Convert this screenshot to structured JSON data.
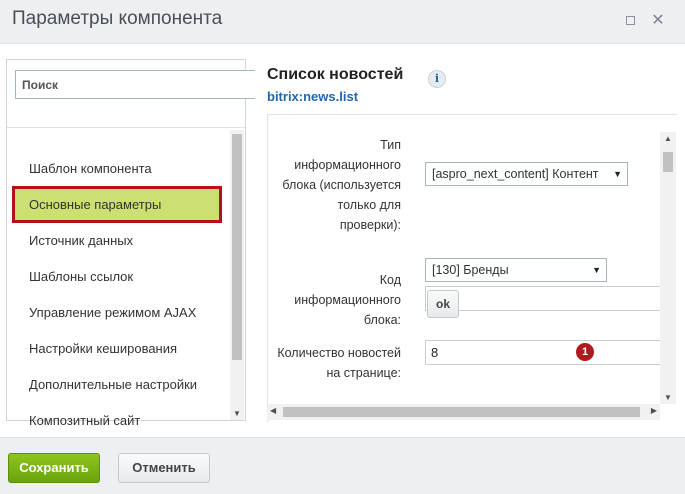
{
  "window": {
    "title": "Параметры компонента",
    "maximize_icon": "maximize-icon",
    "close_icon": "close-icon",
    "close_glyph": "✕"
  },
  "sidebar": {
    "search_placeholder": "Поиск",
    "items": [
      {
        "label": "Шаблон компонента"
      },
      {
        "label": "Основные параметры",
        "active": true
      },
      {
        "label": "Источник данных"
      },
      {
        "label": "Шаблоны ссылок"
      },
      {
        "label": "Управление режимом AJAX"
      },
      {
        "label": "Настройки кеширования"
      },
      {
        "label": "Дополнительные настройки"
      },
      {
        "label": "Композитный сайт"
      }
    ]
  },
  "component": {
    "title": "Список новостей",
    "info_glyph": "i",
    "code": "bitrix:news.list"
  },
  "properties": {
    "iblock_type": {
      "label_lines": [
        "Тип",
        "информационного",
        "блока (используется",
        "только для",
        "проверки):"
      ],
      "value": "[aspro_next_content] Контент"
    },
    "iblock_id": {
      "label_lines": [
        "Код",
        "информационного",
        "блока:"
      ],
      "value": "[130] Бренды",
      "text_value": "",
      "ok_label": "ok"
    },
    "news_count": {
      "label_lines": [
        "Количество новостей",
        "на странице:"
      ],
      "value": "8",
      "badge": "1"
    }
  },
  "footer": {
    "save_label": "Сохранить",
    "cancel_label": "Отменить"
  },
  "colors": {
    "active_item_bg": "#ccdf73",
    "active_item_border": "#b5101b",
    "save_button": "#7ab317",
    "badge": "#b01a1e",
    "code_link": "#2067b0"
  }
}
